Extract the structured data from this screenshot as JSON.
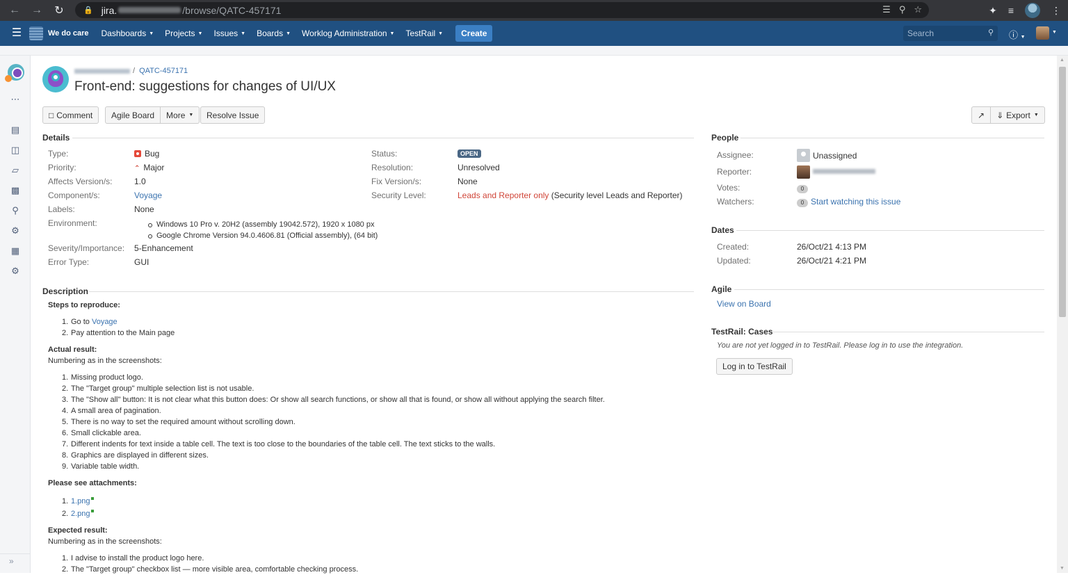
{
  "browser": {
    "url_host": "jira.",
    "url_path": "/browse/QATC-457171"
  },
  "header": {
    "brand": "We do care",
    "menu": [
      {
        "label": "Dashboards"
      },
      {
        "label": "Projects"
      },
      {
        "label": "Issues"
      },
      {
        "label": "Boards"
      },
      {
        "label": "Worklog Administration"
      },
      {
        "label": "TestRail"
      }
    ],
    "create_label": "Create",
    "search_placeholder": "Search"
  },
  "issue": {
    "key": "QATC-457171",
    "title": "Front-end: suggestions for changes of UI/UX"
  },
  "toolbar": {
    "comment": "Comment",
    "agile_board": "Agile Board",
    "more": "More",
    "resolve": "Resolve Issue",
    "export": "Export"
  },
  "details": {
    "title": "Details",
    "type_label": "Type:",
    "type_value": "Bug",
    "priority_label": "Priority:",
    "priority_value": "Major",
    "affects_label": "Affects Version/s:",
    "affects_value": "1.0",
    "components_label": "Component/s:",
    "components_value": "Voyage",
    "labels_label": "Labels:",
    "labels_value": "None",
    "environment_label": "Environment:",
    "environment": [
      "Windows 10 Pro v. 20H2 (assembly 19042.572), 1920 x 1080 px",
      "Google Chrome Version 94.0.4606.81 (Official assembly), (64 bit)"
    ],
    "severity_label": "Severity/Importance:",
    "severity_value": "5-Enhancement",
    "error_label": "Error Type:",
    "error_value": "GUI",
    "status_label": "Status:",
    "status_value": "OPEN",
    "resolution_label": "Resolution:",
    "resolution_value": "Unresolved",
    "fix_label": "Fix Version/s:",
    "fix_value": "None",
    "security_label": "Security Level:",
    "security_value": "Leads and Reporter only",
    "security_note": "(Security level Leads and Reporter)"
  },
  "description": {
    "title": "Description",
    "steps_heading": "Steps to reproduce:",
    "steps": [
      {
        "num": "1.",
        "text": "Go to ",
        "link": "Voyage"
      },
      {
        "num": "2.",
        "text": "Pay attention to the Main page",
        "link": ""
      }
    ],
    "actual_heading": "Actual result:",
    "actual_intro": "Numbering as in the screenshots:",
    "actual_items": [
      "Missing product logo.",
      "The \"Target group\" multiple selection list is not usable.",
      "The \"Show all\" button: It is not clear what this button does: Or show all search functions, or show all that is found, or show all without applying the search filter.",
      "A small area of pagination.",
      "There is no way to set the required amount without scrolling down.",
      "Small clickable area.",
      "Different indents for text inside a table cell. The text is too close to the boundaries of the table cell. The text sticks to the walls.",
      "Graphics are displayed in different sizes.",
      "Variable table width."
    ],
    "attachments_heading": "Please see attachments:",
    "attachments": [
      "1.png",
      "2.png"
    ],
    "expected_heading": "Expected result:",
    "expected_intro": "Numbering as in the screenshots:",
    "expected_items": [
      "I advise to install the product logo here.",
      "The \"Target group\" checkbox list — more visible area, comfortable checking process."
    ]
  },
  "people": {
    "title": "People",
    "assignee_label": "Assignee:",
    "assignee_value": "Unassigned",
    "reporter_label": "Reporter:",
    "votes_label": "Votes:",
    "votes_value": "0",
    "watchers_label": "Watchers:",
    "watchers_value": "0",
    "watch_link": "Start watching this issue"
  },
  "dates": {
    "title": "Dates",
    "created_label": "Created:",
    "created_value": "26/Oct/21 4:13 PM",
    "updated_label": "Updated:",
    "updated_value": "26/Oct/21 4:21 PM"
  },
  "agile": {
    "title": "Agile",
    "link": "View on Board"
  },
  "testrail": {
    "title": "TestRail: Cases",
    "message": "You are not yet logged in to TestRail. Please log in to use the integration.",
    "login_button": "Log in to TestRail"
  },
  "colors": {
    "header_bg": "#205081",
    "create_bg": "#3b7fc4",
    "link": "#3b73af",
    "status_lozenge": "#4a6785",
    "security_red": "#d04437"
  }
}
